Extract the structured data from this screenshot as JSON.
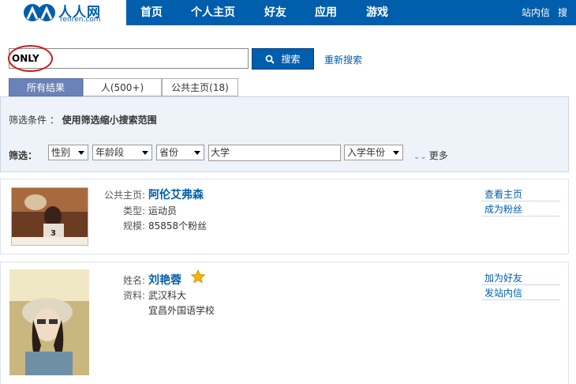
{
  "brand": {
    "name": "人人网",
    "sub": "renren.com"
  },
  "nav": {
    "items": [
      "首页",
      "个人主页",
      "好友",
      "应用",
      "游戏"
    ],
    "right": [
      "站内信",
      "搜索"
    ]
  },
  "search": {
    "query": "ONLY",
    "button_label": "搜索",
    "reset_label": "重新搜索"
  },
  "tabs": [
    "所有结果",
    "人(500+)",
    "公共主页(18)"
  ],
  "filter": {
    "condition_label": "筛选条件 ：",
    "condition_hint": "使用筛选缩小搜索范围",
    "label": "筛选：",
    "gender": "性别",
    "age": "年龄段",
    "province": "省份",
    "school": "大学",
    "enroll_year": "入学年份",
    "more": "更多"
  },
  "results": [
    {
      "key_title": "公共主页:",
      "title": "阿伦艾弗森",
      "key_type": "类型:",
      "type": "运动员",
      "key_scale": "规模:",
      "scale": "85858个粉丝",
      "actions": [
        "查看主页",
        "成为粉丝"
      ]
    },
    {
      "key_name": "姓名:",
      "name": "刘艳蓉",
      "key_info": "资料:",
      "info1": "武汉科大",
      "info2": "宜昌外国语学校",
      "actions": [
        "加为好友",
        "发站内信"
      ]
    }
  ]
}
